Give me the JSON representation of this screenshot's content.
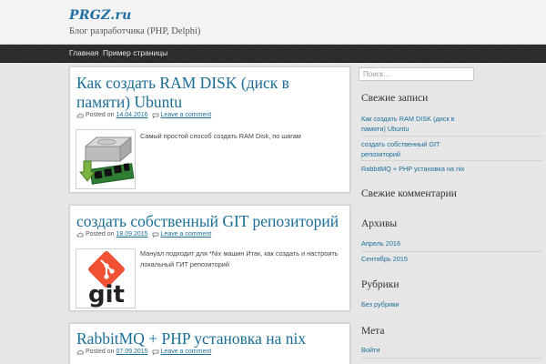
{
  "site": {
    "title": "PRGZ.ru",
    "description": "Блог разработчика (PHP, Delphi)"
  },
  "nav": {
    "items": [
      {
        "label": "Главная"
      },
      {
        "label": "Пример страницы"
      }
    ]
  },
  "posts": [
    {
      "title": "Как создать RAM DISK (диск в памяти) Ubuntu",
      "posted_on": "Posted on",
      "date": "14.04.2016",
      "comment_link": "Leave a comment",
      "excerpt": "Самый простой способ создать RAM Disk, по шагам",
      "thumb_icon": "ram-disk-icon"
    },
    {
      "title": "создать собственный GIT репозиторий",
      "posted_on": "Posted on",
      "date": "18.09.2015",
      "comment_link": "Leave a comment",
      "excerpt": "Мануал подходит для *Nix машин Итак, как создать и настроить локальный ГИТ репозиторий",
      "thumb_icon": "git-logo",
      "thumb_text": "git"
    },
    {
      "title": "RabbitMQ + PHP установка на nix",
      "posted_on": "Posted on",
      "date": "07.09.2015",
      "comment_link": "Leave a comment"
    }
  ],
  "sidebar": {
    "search_placeholder": "Поиск…",
    "recent_posts": {
      "title": "Свежие записи",
      "items": [
        {
          "label": "Как создать RAM DISK (диск в памяти) Ubuntu"
        },
        {
          "label": "создать собственный GIT репозиторий"
        },
        {
          "label": "RabbitMQ + PHP установка на nix"
        }
      ]
    },
    "recent_comments": {
      "title": "Свежие комментарии"
    },
    "archives": {
      "title": "Архивы",
      "items": [
        {
          "label": "Апрель 2016"
        },
        {
          "label": "Сентябрь 2015"
        }
      ]
    },
    "categories": {
      "title": "Рубрики",
      "items": [
        {
          "label": "Без рубрики"
        }
      ]
    },
    "meta": {
      "title": "Мета",
      "items": [
        {
          "label": "Войти"
        }
      ]
    }
  },
  "colors": {
    "link": "#1b6e98",
    "nav_bg": "#2b2b2b",
    "page_bg": "#e6e6e6",
    "git_orange": "#f05133"
  }
}
